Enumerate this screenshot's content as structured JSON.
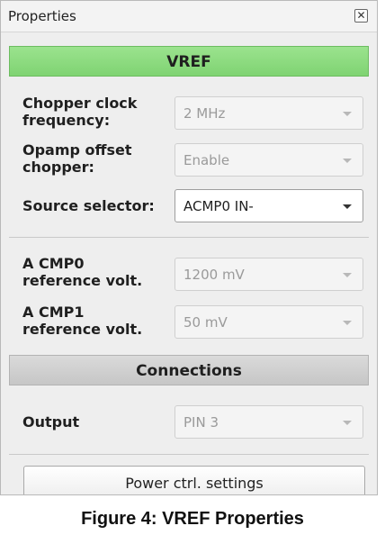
{
  "panel": {
    "title": "Properties",
    "close_icon": "close-icon",
    "close_glyph": "✕"
  },
  "vref": {
    "heading": "VREF",
    "heading_color": "#8ddc80",
    "chopper_clock": {
      "label_line1": "Chopper clock",
      "label_line2": "frequency:",
      "value": "2 MHz"
    },
    "opamp_offset": {
      "label_line1": "Opamp offset",
      "label_line2": "chopper:",
      "value": "Enable"
    },
    "source_selector": {
      "label": "Source selector:",
      "value": "ACMP0 IN-"
    },
    "acmp0_ref": {
      "label_line1": "A CMP0",
      "label_line2": "reference volt.",
      "value": "1200 mV"
    },
    "acmp1_ref": {
      "label_line1": "A CMP1",
      "label_line2": "reference volt.",
      "value": "50 mV"
    }
  },
  "connections": {
    "heading": "Connections",
    "output": {
      "label": "Output",
      "value": "PIN 3"
    }
  },
  "power_button": {
    "label": "Power ctrl. settings"
  },
  "caption": "Figure 4: VREF Properties"
}
